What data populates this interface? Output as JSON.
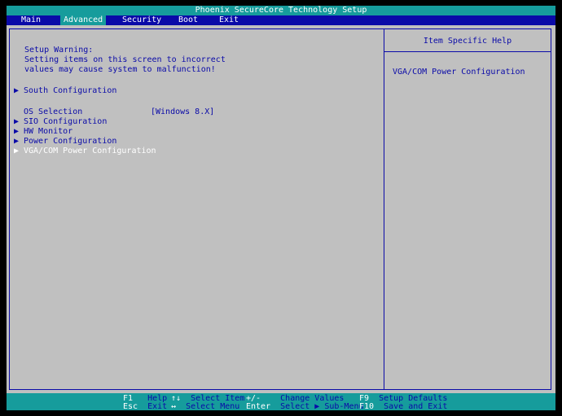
{
  "header": {
    "title": "Phoenix SecureCore Technology Setup",
    "tabs": [
      "Main",
      "Advanced",
      "Security",
      "Boot",
      "Exit"
    ],
    "active_tab": "Advanced"
  },
  "warning": {
    "line1": "Setup Warning:",
    "line2": "Setting items on this screen to incorrect",
    "line3": "values may cause system to malfunction!"
  },
  "items": {
    "south": "South Configuration",
    "os_label": "OS Selection",
    "os_value": "[Windows 8.X]",
    "sio": "SIO Configuration",
    "hw": "HW Monitor",
    "power": "Power Configuration",
    "vga": "VGA/COM Power Configuration"
  },
  "help": {
    "title": "Item Specific Help",
    "text": "VGA/COM Power Configuration"
  },
  "footer": {
    "row1": [
      {
        "key": "F1",
        "desc": "Help"
      },
      {
        "key": "↑↓",
        "desc": "Select Item"
      },
      {
        "key": "+/-",
        "desc": "Change Values"
      },
      {
        "key": "F9",
        "desc": "Setup Defaults"
      }
    ],
    "row2": [
      {
        "key": "Esc",
        "desc": "Exit"
      },
      {
        "key": "↔",
        "desc": "Select Menu"
      },
      {
        "key": "Enter",
        "desc": "Select ▶ Sub-Menu"
      },
      {
        "key": "F10",
        "desc": "Save and Exit"
      }
    ]
  },
  "colors": {
    "cyan": "#169c9c",
    "blue": "#0a0aa8",
    "gray": "#c0c0c0",
    "white": "#ffffff"
  }
}
